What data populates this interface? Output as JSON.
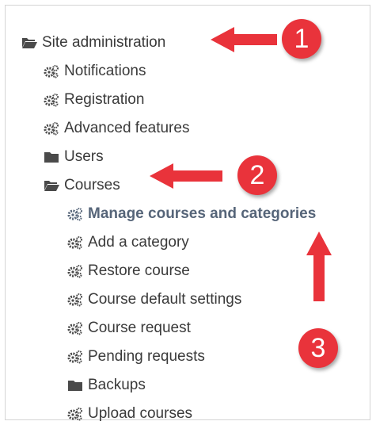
{
  "tree": {
    "root": {
      "label": "Site administration",
      "icon": "folder-open-icon"
    },
    "items": [
      {
        "label": "Notifications",
        "icon": "gears-icon"
      },
      {
        "label": "Registration",
        "icon": "gears-icon"
      },
      {
        "label": "Advanced features",
        "icon": "gears-icon"
      },
      {
        "label": "Users",
        "icon": "folder-icon"
      },
      {
        "label": "Courses",
        "icon": "folder-open-icon"
      }
    ],
    "courses_children": [
      {
        "label": "Manage courses and categories",
        "icon": "gears-icon",
        "active": true
      },
      {
        "label": "Add a category",
        "icon": "gears-icon"
      },
      {
        "label": "Restore course",
        "icon": "gears-icon"
      },
      {
        "label": "Course default settings",
        "icon": "gears-icon"
      },
      {
        "label": "Course request",
        "icon": "gears-icon"
      },
      {
        "label": "Pending requests",
        "icon": "gears-icon"
      },
      {
        "label": "Backups",
        "icon": "folder-icon"
      },
      {
        "label": "Upload courses",
        "icon": "gears-icon"
      }
    ]
  },
  "callouts": [
    "1",
    "2",
    "3"
  ],
  "colors": {
    "callout": "#e9333b",
    "active_text": "#566579",
    "text": "#3a3a3a",
    "icon": "#4a4a4a"
  }
}
